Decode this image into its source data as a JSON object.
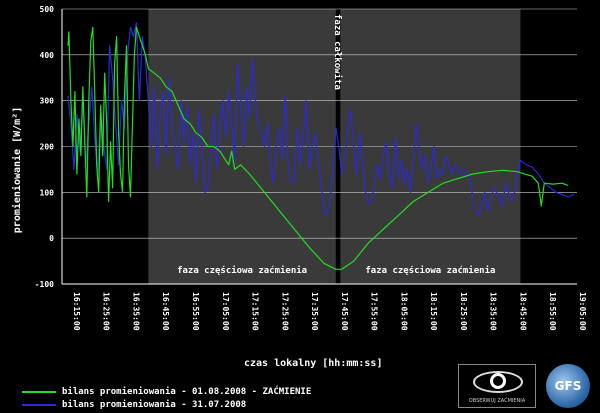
{
  "chart_data": {
    "type": "line",
    "xlabel": "czas lokalny [hh:mm:ss]",
    "ylabel": "promieniowanie [W/m²]",
    "ylim": [
      -100,
      500
    ],
    "xlim": [
      "16:12:00",
      "19:05:00"
    ],
    "y_ticks": [
      -100,
      0,
      100,
      200,
      300,
      400,
      500
    ],
    "x_ticks": [
      "16:15:00",
      "16:25:00",
      "16:35:00",
      "16:45:00",
      "16:55:00",
      "17:05:00",
      "17:15:00",
      "17:25:00",
      "17:35:00",
      "17:45:00",
      "17:55:00",
      "18:05:00",
      "18:15:00",
      "18:25:00",
      "18:35:00",
      "18:45:00",
      "18:55:00",
      "19:05:00"
    ],
    "bands": [
      {
        "from": "16:41:00",
        "to": "17:44:00",
        "label": "faza częściowa zaćmienia",
        "color": "#3a3a3a"
      },
      {
        "from": "17:44:00",
        "to": "17:45:30",
        "label": "faza całkowita",
        "color": "#000000"
      },
      {
        "from": "17:45:30",
        "to": "18:46:00",
        "label": "faza częściowa zaćmienia",
        "color": "#3a3a3a"
      }
    ],
    "series": [
      {
        "name": "bilans promieniowania - 01.08.2008 - ZAĆMIENIE",
        "color": "#22dd22",
        "points": [
          [
            "16:14:00",
            420
          ],
          [
            "16:14:20",
            450
          ],
          [
            "16:15:00",
            300
          ],
          [
            "16:15:40",
            200
          ],
          [
            "16:16:20",
            320
          ],
          [
            "16:17:00",
            140
          ],
          [
            "16:17:40",
            260
          ],
          [
            "16:18:20",
            180
          ],
          [
            "16:19:00",
            330
          ],
          [
            "16:19:40",
            210
          ],
          [
            "16:20:20",
            90
          ],
          [
            "16:21:00",
            300
          ],
          [
            "16:21:40",
            430
          ],
          [
            "16:22:20",
            460
          ],
          [
            "16:23:00",
            320
          ],
          [
            "16:23:40",
            160
          ],
          [
            "16:24:20",
            100
          ],
          [
            "16:25:00",
            290
          ],
          [
            "16:25:40",
            180
          ],
          [
            "16:26:20",
            360
          ],
          [
            "16:27:00",
            250
          ],
          [
            "16:27:40",
            80
          ],
          [
            "16:28:20",
            210
          ],
          [
            "16:29:00",
            110
          ],
          [
            "16:29:40",
            380
          ],
          [
            "16:30:20",
            440
          ],
          [
            "16:31:00",
            230
          ],
          [
            "16:31:40",
            140
          ],
          [
            "16:32:20",
            100
          ],
          [
            "16:33:00",
            310
          ],
          [
            "16:33:40",
            420
          ],
          [
            "16:34:20",
            160
          ],
          [
            "16:35:00",
            90
          ],
          [
            "16:35:40",
            250
          ],
          [
            "16:36:20",
            400
          ],
          [
            "16:37:00",
            460
          ],
          [
            "16:38:00",
            440
          ],
          [
            "16:39:00",
            420
          ],
          [
            "16:40:00",
            400
          ],
          [
            "16:41:00",
            370
          ],
          [
            "16:43:00",
            360
          ],
          [
            "16:45:00",
            350
          ],
          [
            "16:47:00",
            330
          ],
          [
            "16:49:00",
            320
          ],
          [
            "16:51:00",
            290
          ],
          [
            "16:53:00",
            260
          ],
          [
            "16:55:00",
            250
          ],
          [
            "16:57:00",
            230
          ],
          [
            "16:59:00",
            220
          ],
          [
            "17:01:00",
            200
          ],
          [
            "17:03:00",
            200
          ],
          [
            "17:05:00",
            190
          ],
          [
            "17:07:00",
            170
          ],
          [
            "17:08:00",
            160
          ],
          [
            "17:09:00",
            190
          ],
          [
            "17:10:00",
            150
          ],
          [
            "17:12:00",
            160
          ],
          [
            "17:15:00",
            140
          ],
          [
            "17:20:00",
            100
          ],
          [
            "17:25:00",
            60
          ],
          [
            "17:30:00",
            20
          ],
          [
            "17:35:00",
            -20
          ],
          [
            "17:40:00",
            -55
          ],
          [
            "17:44:00",
            -68
          ],
          [
            "17:46:00",
            -68
          ],
          [
            "17:50:00",
            -50
          ],
          [
            "17:55:00",
            -10
          ],
          [
            "18:00:00",
            20
          ],
          [
            "18:05:00",
            50
          ],
          [
            "18:10:00",
            80
          ],
          [
            "18:15:00",
            100
          ],
          [
            "18:20:00",
            120
          ],
          [
            "18:25:00",
            130
          ],
          [
            "18:30:00",
            140
          ],
          [
            "18:35:00",
            145
          ],
          [
            "18:40:00",
            148
          ],
          [
            "18:45:00",
            145
          ],
          [
            "18:50:00",
            135
          ],
          [
            "18:52:00",
            120
          ],
          [
            "18:53:00",
            70
          ],
          [
            "18:54:00",
            120
          ],
          [
            "18:57:00",
            118
          ],
          [
            "19:00:00",
            120
          ],
          [
            "19:02:00",
            115
          ]
        ]
      },
      {
        "name": "bilans promieniowania - 31.07.2008",
        "color": "#2a2ad6",
        "points": [
          [
            "16:14:00",
            310
          ],
          [
            "16:15:00",
            250
          ],
          [
            "16:16:00",
            150
          ],
          [
            "16:17:00",
            270
          ],
          [
            "16:18:00",
            190
          ],
          [
            "16:19:00",
            300
          ],
          [
            "16:20:00",
            160
          ],
          [
            "16:21:00",
            250
          ],
          [
            "16:22:00",
            330
          ],
          [
            "16:23:00",
            220
          ],
          [
            "16:24:00",
            140
          ],
          [
            "16:25:00",
            280
          ],
          [
            "16:26:00",
            200
          ],
          [
            "16:27:00",
            150
          ],
          [
            "16:28:00",
            420
          ],
          [
            "16:29:00",
            350
          ],
          [
            "16:30:00",
            250
          ],
          [
            "16:31:00",
            160
          ],
          [
            "16:32:00",
            300
          ],
          [
            "16:33:00",
            240
          ],
          [
            "16:34:00",
            400
          ],
          [
            "16:35:00",
            460
          ],
          [
            "16:36:00",
            440
          ],
          [
            "16:37:00",
            470
          ],
          [
            "16:38:00",
            300
          ],
          [
            "16:39:00",
            440
          ],
          [
            "16:40:00",
            390
          ],
          [
            "16:41:00",
            300
          ],
          [
            "16:42:00",
            200
          ],
          [
            "16:43:00",
            330
          ],
          [
            "16:44:00",
            150
          ],
          [
            "16:45:00",
            280
          ],
          [
            "16:46:00",
            320
          ],
          [
            "16:47:00",
            180
          ],
          [
            "16:48:00",
            350
          ],
          [
            "16:49:00",
            240
          ],
          [
            "16:50:00",
            200
          ],
          [
            "16:51:00",
            150
          ],
          [
            "16:52:00",
            300
          ],
          [
            "16:53:00",
            210
          ],
          [
            "16:54:00",
            290
          ],
          [
            "16:55:00",
            160
          ],
          [
            "16:56:00",
            230
          ],
          [
            "16:57:00",
            120
          ],
          [
            "16:58:00",
            280
          ],
          [
            "16:59:00",
            200
          ],
          [
            "17:00:00",
            100
          ],
          [
            "17:01:00",
            105
          ],
          [
            "17:02:00",
            200
          ],
          [
            "17:03:00",
            270
          ],
          [
            "17:04:00",
            150
          ],
          [
            "17:05:00",
            240
          ],
          [
            "17:06:00",
            300
          ],
          [
            "17:07:00",
            220
          ],
          [
            "17:08:00",
            320
          ],
          [
            "17:09:00",
            250
          ],
          [
            "17:10:00",
            170
          ],
          [
            "17:11:00",
            380
          ],
          [
            "17:12:00",
            300
          ],
          [
            "17:13:00",
            200
          ],
          [
            "17:14:00",
            330
          ],
          [
            "17:15:00",
            260
          ],
          [
            "17:16:00",
            390
          ],
          [
            "17:17:00",
            300
          ],
          [
            "17:18:00",
            240
          ],
          [
            "17:19:00",
            230
          ],
          [
            "17:20:00",
            200
          ],
          [
            "17:21:00",
            250
          ],
          [
            "17:22:00",
            160
          ],
          [
            "17:23:00",
            120
          ],
          [
            "17:24:00",
            200
          ],
          [
            "17:25:00",
            240
          ],
          [
            "17:26:00",
            170
          ],
          [
            "17:27:00",
            310
          ],
          [
            "17:28:00",
            160
          ],
          [
            "17:29:00",
            120
          ],
          [
            "17:30:00",
            120
          ],
          [
            "17:31:00",
            240
          ],
          [
            "17:32:00",
            160
          ],
          [
            "17:33:00",
            220
          ],
          [
            "17:34:00",
            300
          ],
          [
            "17:35:00",
            150
          ],
          [
            "17:36:00",
            200
          ],
          [
            "17:37:00",
            230
          ],
          [
            "17:38:00",
            170
          ],
          [
            "17:39:00",
            120
          ],
          [
            "17:40:00",
            60
          ],
          [
            "17:41:00",
            50
          ],
          [
            "17:42:00",
            80
          ],
          [
            "17:43:00",
            150
          ],
          [
            "17:44:00",
            240
          ],
          [
            "17:45:00",
            200
          ],
          [
            "17:46:00",
            140
          ],
          [
            "17:47:00",
            170
          ],
          [
            "17:48:00",
            240
          ],
          [
            "17:49:00",
            280
          ],
          [
            "17:50:00",
            200
          ],
          [
            "17:51:00",
            140
          ],
          [
            "17:52:00",
            230
          ],
          [
            "17:53:00",
            160
          ],
          [
            "17:54:00",
            100
          ],
          [
            "17:55:00",
            75
          ],
          [
            "17:56:00",
            80
          ],
          [
            "17:57:00",
            120
          ],
          [
            "17:58:00",
            160
          ],
          [
            "17:59:00",
            130
          ],
          [
            "18:00:00",
            180
          ],
          [
            "18:01:00",
            210
          ],
          [
            "18:02:00",
            130
          ],
          [
            "18:03:00",
            110
          ],
          [
            "18:04:00",
            220
          ],
          [
            "18:05:00",
            130
          ],
          [
            "18:06:00",
            170
          ],
          [
            "18:07:00",
            120
          ],
          [
            "18:08:00",
            150
          ],
          [
            "18:09:00",
            100
          ],
          [
            "18:10:00",
            170
          ],
          [
            "18:11:00",
            250
          ],
          [
            "18:12:00",
            200
          ],
          [
            "18:13:00",
            150
          ],
          [
            "18:14:00",
            180
          ],
          [
            "18:15:00",
            120
          ],
          [
            "18:16:00",
            150
          ],
          [
            "18:17:00",
            200
          ],
          [
            "18:18:00",
            130
          ],
          [
            "18:19:00",
            150
          ],
          [
            "18:20:00",
            140
          ],
          [
            "18:21:00",
            180
          ],
          [
            "18:22:00",
            160
          ],
          [
            "18:23:00",
            140
          ],
          [
            "18:24:00",
            160
          ],
          [
            "18:25:00",
            150
          ],
          [
            "18:26:00",
            140
          ],
          [
            "18:27:00",
            150
          ],
          [
            "18:28:00",
            140
          ],
          [
            "18:29:00",
            130
          ],
          [
            "18:30:00",
            90
          ],
          [
            "18:31:00",
            60
          ],
          [
            "18:32:00",
            50
          ],
          [
            "18:33:00",
            70
          ],
          [
            "18:34:00",
            100
          ],
          [
            "18:35:00",
            60
          ],
          [
            "18:36:00",
            80
          ],
          [
            "18:37:00",
            110
          ],
          [
            "18:38:00",
            100
          ],
          [
            "18:39:00",
            90
          ],
          [
            "18:40:00",
            70
          ],
          [
            "18:41:00",
            120
          ],
          [
            "18:42:00",
            100
          ],
          [
            "18:43:00",
            80
          ],
          [
            "18:44:00",
            100
          ],
          [
            "18:45:00",
            140
          ],
          [
            "18:46:00",
            170
          ],
          [
            "18:48:00",
            160
          ],
          [
            "18:50:00",
            155
          ],
          [
            "18:52:00",
            140
          ],
          [
            "18:54:00",
            120
          ],
          [
            "18:56:00",
            110
          ],
          [
            "18:58:00",
            100
          ],
          [
            "19:00:00",
            95
          ],
          [
            "19:02:00",
            90
          ],
          [
            "19:04:00",
            95
          ]
        ]
      }
    ]
  },
  "logos": {
    "observer_text": "OBSERWUJ ZAĆMIENIA",
    "badge_text": "GFS"
  }
}
